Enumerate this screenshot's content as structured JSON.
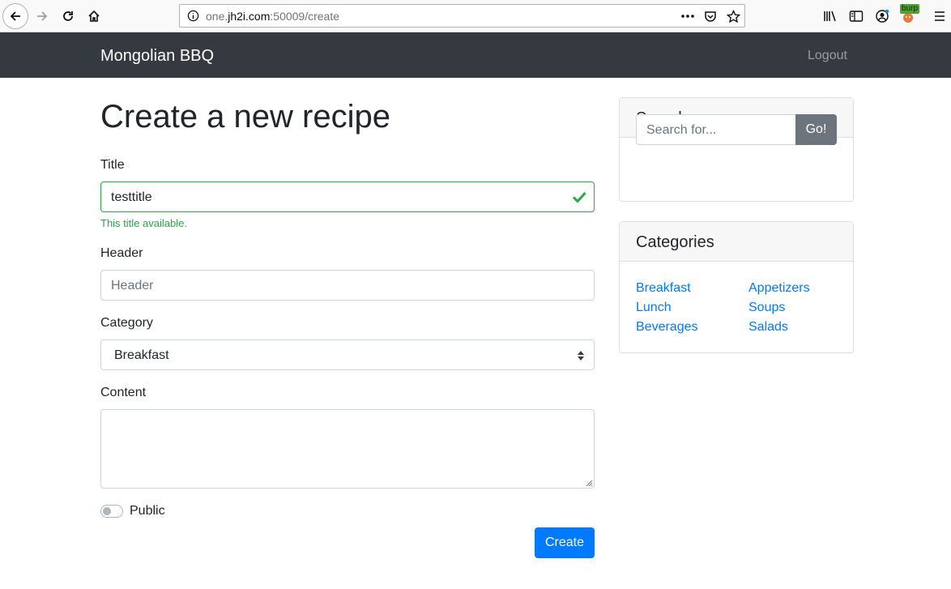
{
  "browser": {
    "url_prefix": "one.",
    "url_domain": "jh2i.com",
    "url_rest": ":50009/create",
    "burp_badge": "burp"
  },
  "navbar": {
    "brand": "Mongolian BBQ",
    "logout": "Logout"
  },
  "form": {
    "heading": "Create a new recipe",
    "title_label": "Title",
    "title_value": "testtitle",
    "title_feedback": "This title available.",
    "header_label": "Header",
    "header_placeholder": "Header",
    "category_label": "Category",
    "category_value": "Breakfast",
    "content_label": "Content",
    "public_label": "Public",
    "create_button": "Create"
  },
  "search_card": {
    "title": "Search",
    "placeholder": "Search for...",
    "go_button": "Go!"
  },
  "categories_card": {
    "title": "Categories",
    "left": [
      "Breakfast",
      "Lunch",
      "Beverages"
    ],
    "right": [
      "Appetizers",
      "Soups",
      "Salads"
    ]
  },
  "colors": {
    "navbar_bg": "#343a40",
    "primary": "#007bff",
    "success": "#28a745",
    "secondary": "#6c757d"
  }
}
